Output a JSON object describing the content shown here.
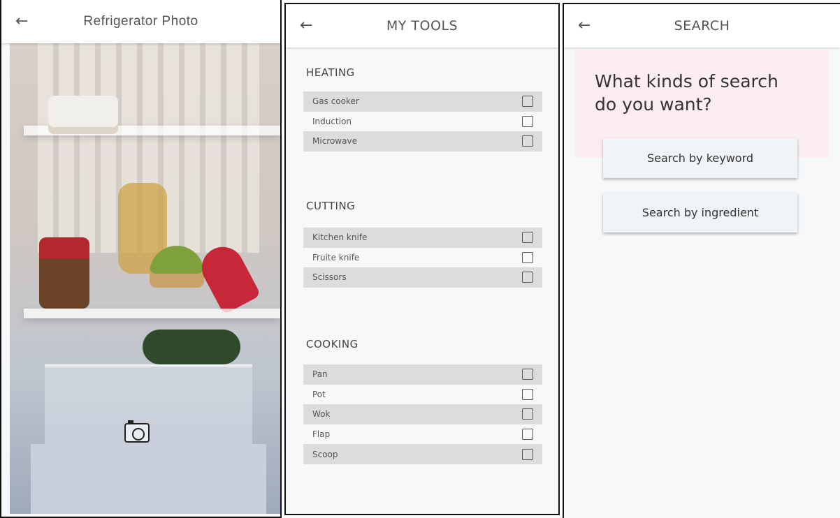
{
  "screens": {
    "photo": {
      "title": "Refrigerator Photo",
      "back_icon": "arrow-left-icon",
      "camera_icon": "camera-icon"
    },
    "tools": {
      "title": "MY TOOLS",
      "back_icon": "arrow-left-icon",
      "sections": [
        {
          "title": "HEATING",
          "items": [
            "Gas cooker",
            "Induction",
            "Microwave"
          ]
        },
        {
          "title": "CUTTING",
          "items": [
            "Kitchen knife",
            "Fruite knife",
            "Scissors"
          ]
        },
        {
          "title": "COOKING",
          "items": [
            "Pan",
            "Pot",
            "Wok",
            "Flap",
            "Scoop"
          ]
        }
      ]
    },
    "search": {
      "title": "SEARCH",
      "back_icon": "arrow-left-icon",
      "question": "What kinds of search do you want?",
      "buttons": {
        "keyword": "Search by keyword",
        "ingredient": "Search by ingredient"
      },
      "card_color": "#fcedf2"
    }
  }
}
